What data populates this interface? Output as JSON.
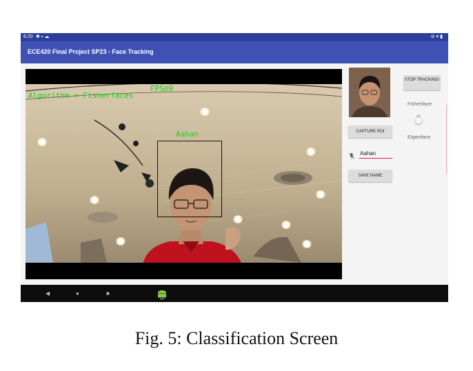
{
  "status_bar": {
    "time": "6:20",
    "left_icons": [
      "gear-icon",
      "image-icon",
      "cloud-icon"
    ],
    "right_icons": [
      "mute-icon",
      "wifi-icon",
      "battery-icon"
    ]
  },
  "app_bar": {
    "title": "ECE420 Final Project SP23 - Face Tracking"
  },
  "camera_overlay": {
    "algorithm_text": "Algorithm = Fisherfaces",
    "fps_text": "FPS@9",
    "face_label": "Aahan"
  },
  "controls": {
    "stop_tracking_label": "STOP TRACKING!",
    "capture_roi_label": "CAPTURE ROI",
    "save_name_label": "SAVE NAME",
    "name_input_value": "Aahan",
    "toggle_top_label": "Fisherface",
    "toggle_bottom_label": "Eigenface"
  },
  "nav_bar": {
    "icons": [
      "back-icon",
      "home-icon",
      "recents-icon",
      "android-icon"
    ]
  },
  "caption": "Fig. 5: Classification Screen",
  "colors": {
    "app_bar": "#3f51b5",
    "status_bar": "#2c3e9a",
    "overlay_text": "#14d414",
    "accent": "#d81b60"
  }
}
